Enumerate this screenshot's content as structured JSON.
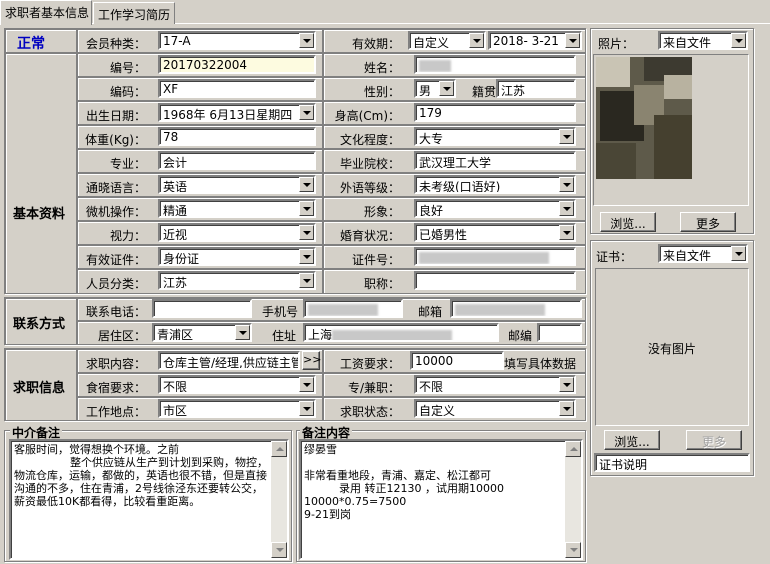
{
  "tabs": [
    "求职者基本信息",
    "工作学习简历"
  ],
  "status": "正常",
  "member_type_label": "会员种类：",
  "member_type": "17-A",
  "validity_label": "有效期：",
  "validity_mode": "自定义",
  "validity_date": "2018- 3-21",
  "photo_label": "照片：",
  "photo_source": "来自文件",
  "browse_label": "浏览...",
  "more_label": "更多",
  "cert_label": "证书：",
  "cert_source": "来自文件",
  "no_image": "没有图片",
  "cert_desc": "证书说明",
  "section_basic": "基本资料",
  "section_contact": "联系方式",
  "section_job": "求职信息",
  "fields": {
    "id_label": "编号：",
    "id": "20170322004",
    "name_label": "姓名：",
    "code_label": "编码：",
    "code": "XF",
    "gender_label": "性别：",
    "gender": "男",
    "origin_label": "籍贯",
    "origin": "江苏",
    "birth_label": "出生日期：",
    "birth": "1968年 6月13日星期四",
    "height_label": "身高(Cm)：",
    "height": "179",
    "weight_label": "体重(Kg)：",
    "weight": "78",
    "edu_label": "文化程度：",
    "edu": "大专",
    "major_label": "专业：",
    "major": "会计",
    "school_label": "毕业院校：",
    "school": "武汉理工大学",
    "lang_label": "通晓语言：",
    "lang": "英语",
    "lang_level_label": "外语等级：",
    "lang_level": "未考级(口语好)",
    "pc_label": "微机操作：",
    "pc": "精通",
    "image_label": "形象：",
    "image": "良好",
    "vision_label": "视力：",
    "vision": "近视",
    "marital_label": "婚育状况：",
    "marital": "已婚男性",
    "idtype_label": "有效证件：",
    "idtype": "身份证",
    "idno_label": "证件号：",
    "category_label": "人员分类：",
    "category": "江苏",
    "title_label": "职称："
  },
  "contact": {
    "phone_label": "联系电话：",
    "mobile_label": "手机号",
    "email_label": "邮箱",
    "district_label": "居住区：",
    "district": "青浦区",
    "address_label": "住址",
    "address": "上海",
    "postcode_label": "邮编"
  },
  "job": {
    "content_label": "求职内容：",
    "content": "仓库主管/经理,供应链主管",
    "expand": ">>",
    "salary_label": "工资要求：",
    "salary": "10000",
    "salary_hint": "填写具体数据",
    "board_label": "食宿要求：",
    "board": "不限",
    "ptft_label": "专/兼职：",
    "ptft": "不限",
    "location_label": "工作地点：",
    "location": "市区",
    "state_label": "求职状态：",
    "state": "自定义"
  },
  "agent_notes_title": "中介备注",
  "agent_notes": "客服时间，觉得想换个环境。之前\n                整个供应链从生产到计划到采购，物控，物流仓库，运输，都做的，英语也很不错，但是直接沟通的不多，住在青浦，2号线徐泾东还要转公交，薪资最低10K都看得，比较看重距离。",
  "remarks_title": "备注内容",
  "remarks": "缪晏雪\n\n非常看重地段，青浦、嘉定、松江都可\n          录用 转正12130 ，试用期10000\n10000*0.75=7500\n9-21到岗"
}
